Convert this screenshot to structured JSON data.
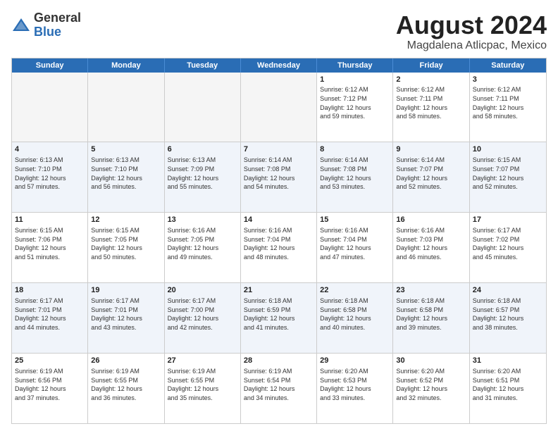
{
  "logo": {
    "general": "General",
    "blue": "Blue"
  },
  "title": {
    "month": "August 2024",
    "location": "Magdalena Atlicpac, Mexico"
  },
  "weekdays": [
    "Sunday",
    "Monday",
    "Tuesday",
    "Wednesday",
    "Thursday",
    "Friday",
    "Saturday"
  ],
  "rows": [
    [
      {
        "day": "",
        "info": "",
        "empty": true
      },
      {
        "day": "",
        "info": "",
        "empty": true
      },
      {
        "day": "",
        "info": "",
        "empty": true
      },
      {
        "day": "",
        "info": "",
        "empty": true
      },
      {
        "day": "1",
        "info": "Sunrise: 6:12 AM\nSunset: 7:12 PM\nDaylight: 12 hours\nand 59 minutes."
      },
      {
        "day": "2",
        "info": "Sunrise: 6:12 AM\nSunset: 7:11 PM\nDaylight: 12 hours\nand 58 minutes."
      },
      {
        "day": "3",
        "info": "Sunrise: 6:12 AM\nSunset: 7:11 PM\nDaylight: 12 hours\nand 58 minutes."
      }
    ],
    [
      {
        "day": "4",
        "info": "Sunrise: 6:13 AM\nSunset: 7:10 PM\nDaylight: 12 hours\nand 57 minutes."
      },
      {
        "day": "5",
        "info": "Sunrise: 6:13 AM\nSunset: 7:10 PM\nDaylight: 12 hours\nand 56 minutes."
      },
      {
        "day": "6",
        "info": "Sunrise: 6:13 AM\nSunset: 7:09 PM\nDaylight: 12 hours\nand 55 minutes."
      },
      {
        "day": "7",
        "info": "Sunrise: 6:14 AM\nSunset: 7:08 PM\nDaylight: 12 hours\nand 54 minutes."
      },
      {
        "day": "8",
        "info": "Sunrise: 6:14 AM\nSunset: 7:08 PM\nDaylight: 12 hours\nand 53 minutes."
      },
      {
        "day": "9",
        "info": "Sunrise: 6:14 AM\nSunset: 7:07 PM\nDaylight: 12 hours\nand 52 minutes."
      },
      {
        "day": "10",
        "info": "Sunrise: 6:15 AM\nSunset: 7:07 PM\nDaylight: 12 hours\nand 52 minutes."
      }
    ],
    [
      {
        "day": "11",
        "info": "Sunrise: 6:15 AM\nSunset: 7:06 PM\nDaylight: 12 hours\nand 51 minutes."
      },
      {
        "day": "12",
        "info": "Sunrise: 6:15 AM\nSunset: 7:05 PM\nDaylight: 12 hours\nand 50 minutes."
      },
      {
        "day": "13",
        "info": "Sunrise: 6:16 AM\nSunset: 7:05 PM\nDaylight: 12 hours\nand 49 minutes."
      },
      {
        "day": "14",
        "info": "Sunrise: 6:16 AM\nSunset: 7:04 PM\nDaylight: 12 hours\nand 48 minutes."
      },
      {
        "day": "15",
        "info": "Sunrise: 6:16 AM\nSunset: 7:04 PM\nDaylight: 12 hours\nand 47 minutes."
      },
      {
        "day": "16",
        "info": "Sunrise: 6:16 AM\nSunset: 7:03 PM\nDaylight: 12 hours\nand 46 minutes."
      },
      {
        "day": "17",
        "info": "Sunrise: 6:17 AM\nSunset: 7:02 PM\nDaylight: 12 hours\nand 45 minutes."
      }
    ],
    [
      {
        "day": "18",
        "info": "Sunrise: 6:17 AM\nSunset: 7:01 PM\nDaylight: 12 hours\nand 44 minutes."
      },
      {
        "day": "19",
        "info": "Sunrise: 6:17 AM\nSunset: 7:01 PM\nDaylight: 12 hours\nand 43 minutes."
      },
      {
        "day": "20",
        "info": "Sunrise: 6:17 AM\nSunset: 7:00 PM\nDaylight: 12 hours\nand 42 minutes."
      },
      {
        "day": "21",
        "info": "Sunrise: 6:18 AM\nSunset: 6:59 PM\nDaylight: 12 hours\nand 41 minutes."
      },
      {
        "day": "22",
        "info": "Sunrise: 6:18 AM\nSunset: 6:58 PM\nDaylight: 12 hours\nand 40 minutes."
      },
      {
        "day": "23",
        "info": "Sunrise: 6:18 AM\nSunset: 6:58 PM\nDaylight: 12 hours\nand 39 minutes."
      },
      {
        "day": "24",
        "info": "Sunrise: 6:18 AM\nSunset: 6:57 PM\nDaylight: 12 hours\nand 38 minutes."
      }
    ],
    [
      {
        "day": "25",
        "info": "Sunrise: 6:19 AM\nSunset: 6:56 PM\nDaylight: 12 hours\nand 37 minutes."
      },
      {
        "day": "26",
        "info": "Sunrise: 6:19 AM\nSunset: 6:55 PM\nDaylight: 12 hours\nand 36 minutes."
      },
      {
        "day": "27",
        "info": "Sunrise: 6:19 AM\nSunset: 6:55 PM\nDaylight: 12 hours\nand 35 minutes."
      },
      {
        "day": "28",
        "info": "Sunrise: 6:19 AM\nSunset: 6:54 PM\nDaylight: 12 hours\nand 34 minutes."
      },
      {
        "day": "29",
        "info": "Sunrise: 6:20 AM\nSunset: 6:53 PM\nDaylight: 12 hours\nand 33 minutes."
      },
      {
        "day": "30",
        "info": "Sunrise: 6:20 AM\nSunset: 6:52 PM\nDaylight: 12 hours\nand 32 minutes."
      },
      {
        "day": "31",
        "info": "Sunrise: 6:20 AM\nSunset: 6:51 PM\nDaylight: 12 hours\nand 31 minutes."
      }
    ]
  ]
}
